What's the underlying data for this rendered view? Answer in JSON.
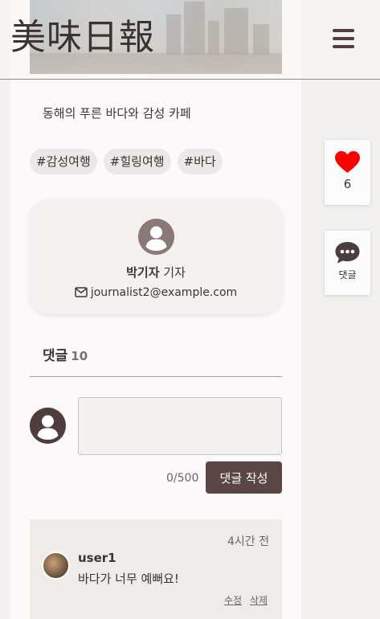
{
  "header": {
    "logo": "美味日報",
    "menu_icon": "hamburger-menu-icon"
  },
  "article": {
    "subtitle": "동해의 푸른 바다와 감성 카페",
    "tags": [
      "#감성여행",
      "#힐링여행",
      "#바다"
    ]
  },
  "author": {
    "name": "박기자",
    "role": "기자",
    "email": "journalist2@example.com",
    "avatar_icon": "user-avatar-icon",
    "email_icon": "envelope-icon"
  },
  "side": {
    "like_count": "6",
    "like_icon": "heart-icon",
    "comment_label": "댓글",
    "comment_icon": "speech-bubble-icon"
  },
  "comments": {
    "title": "댓글",
    "count": "10",
    "input_placeholder": "",
    "char_count": "0/500",
    "submit_label": "댓글 작성",
    "items": [
      {
        "time": "4시간 전",
        "user": "user1",
        "text": "바다가 너무 예뻐요!",
        "edit_label": "수정",
        "delete_label": "삭제"
      }
    ]
  },
  "colors": {
    "brand_brown": "#5a4644",
    "like_red": "#ff0000",
    "background": "#f1f0ef"
  }
}
